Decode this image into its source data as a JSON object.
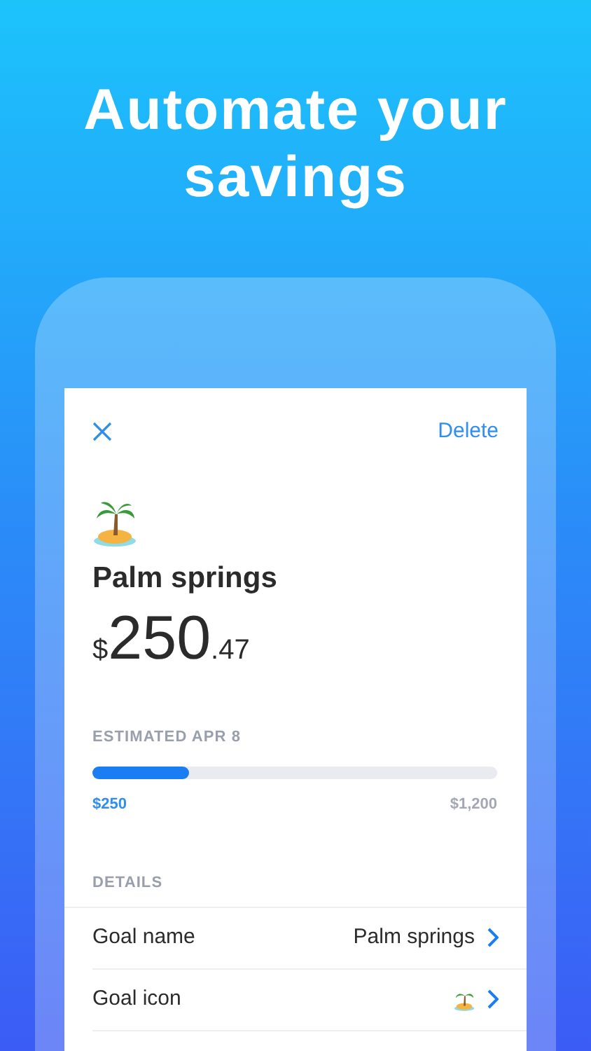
{
  "headline": "Automate your savings",
  "screen": {
    "action": "Delete",
    "goal_title": "Palm springs",
    "amount": {
      "currency": "$",
      "whole": "250",
      "cents": ".47"
    },
    "estimate_label": "ESTIMATED APR 8",
    "progress": {
      "level": 0.24,
      "current": "$250",
      "target": "$1,200"
    },
    "details_label": "DETAILS",
    "rows": [
      {
        "kind": "text",
        "label": "Goal name",
        "value": "Palm springs"
      },
      {
        "kind": "icon",
        "label": "Goal icon"
      }
    ]
  }
}
